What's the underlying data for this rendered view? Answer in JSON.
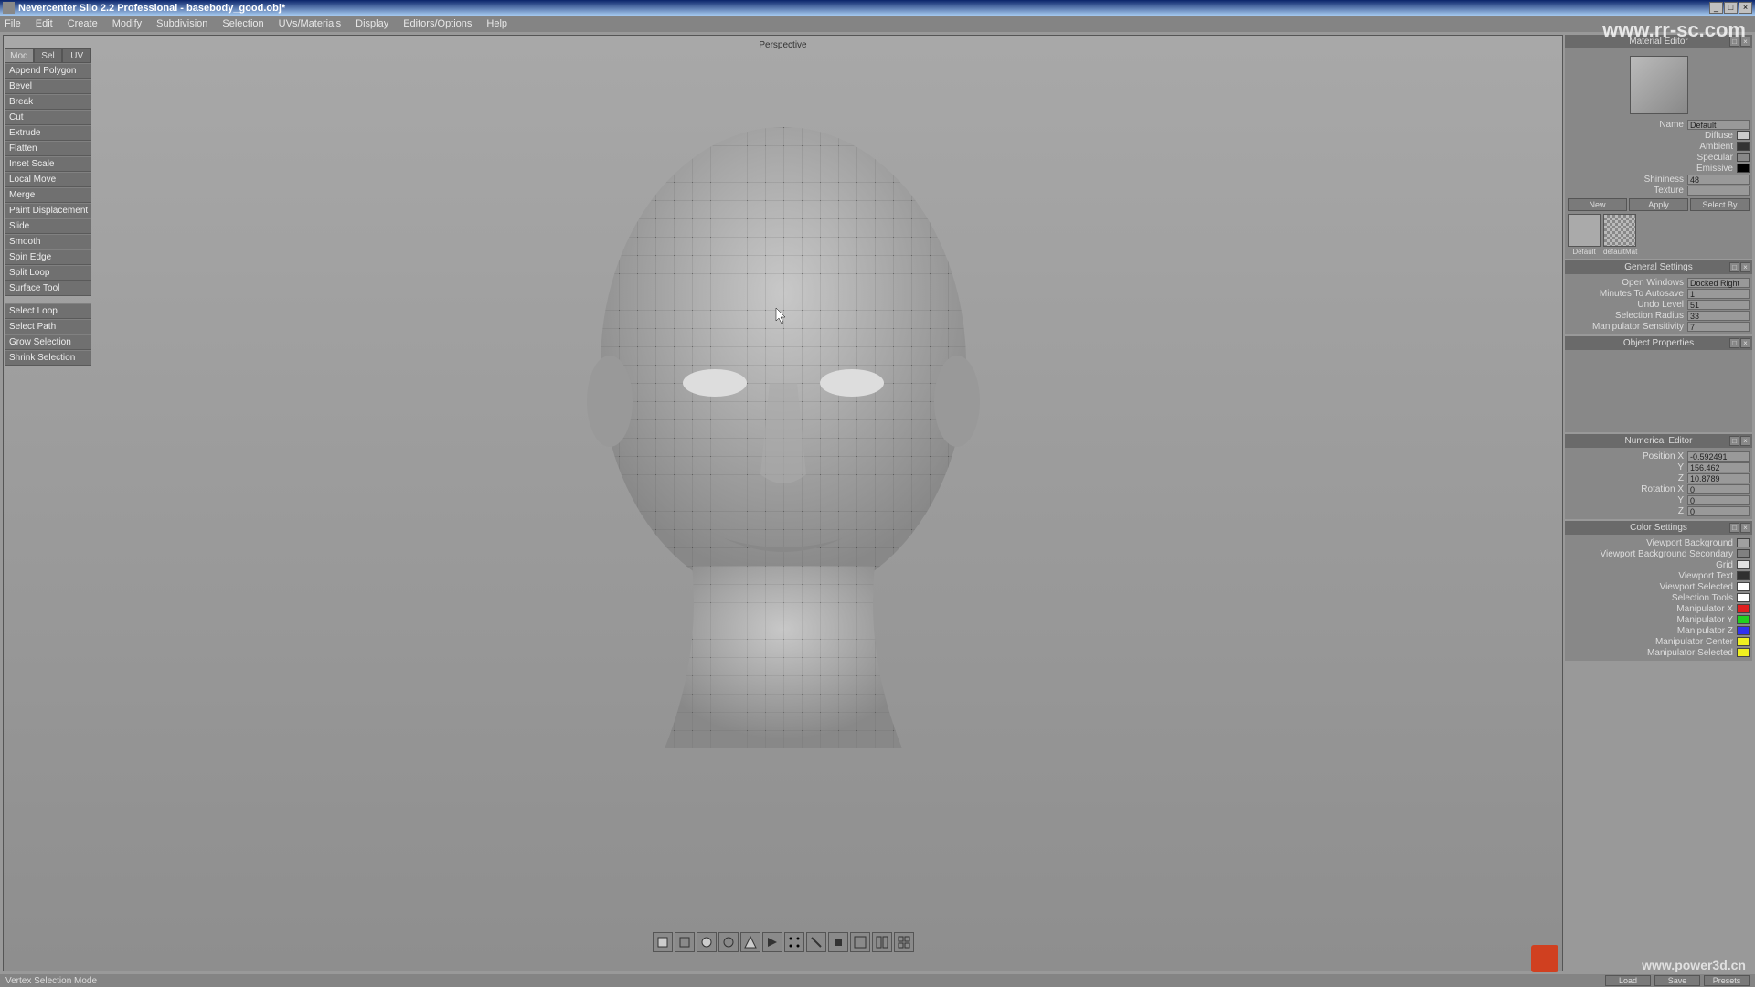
{
  "titlebar": {
    "text": "Nevercenter Silo 2.2 Professional - basebody_good.obj*"
  },
  "menubar": [
    "File",
    "Edit",
    "Create",
    "Modify",
    "Subdivision",
    "Selection",
    "UVs/Materials",
    "Display",
    "Editors/Options",
    "Help"
  ],
  "tabs": [
    "Mod",
    "Sel",
    "UV"
  ],
  "tools_group1": [
    "Append Polygon",
    "Bevel",
    "Break",
    "Cut",
    "Extrude",
    "Flatten",
    "Inset Scale",
    "Local Move",
    "Merge",
    "Paint Displacement",
    "Slide",
    "Smooth",
    "Spin Edge",
    "Split Loop",
    "Surface Tool"
  ],
  "tools_group2": [
    "Select Loop",
    "Select Path",
    "Grow Selection",
    "Shrink Selection"
  ],
  "viewport_label": "Perspective",
  "material_editor": {
    "title": "Material Editor",
    "name_label": "Name",
    "name_val": "Default",
    "diffuse_label": "Diffuse",
    "ambient_label": "Ambient",
    "specular_label": "Specular",
    "emissive_label": "Emissive",
    "shininess_label": "Shininess",
    "shininess_val": "48",
    "texture_label": "Texture",
    "btn_new": "New",
    "btn_apply": "Apply",
    "btn_selectby": "Select By",
    "thumb1": "Default",
    "thumb2": "defaultMat"
  },
  "general_settings": {
    "title": "General Settings",
    "open_windows_l": "Open Windows",
    "open_windows_v": "Docked Right",
    "autosave_l": "Minutes To Autosave",
    "autosave_v": "1",
    "undo_l": "Undo Level",
    "undo_v": "51",
    "selrad_l": "Selection Radius",
    "selrad_v": "33",
    "msens_l": "Manipulator Sensitivity",
    "msens_v": "7"
  },
  "object_properties": {
    "title": "Object Properties"
  },
  "numerical_editor": {
    "title": "Numerical Editor",
    "posx_l": "Position X",
    "posx_v": "-0.592491",
    "posy_l": "Y",
    "posy_v": "156.462",
    "posz_l": "Z",
    "posz_v": "10.8789",
    "rotx_l": "Rotation X",
    "rotx_v": "0",
    "roty_l": "Y",
    "roty_v": "0",
    "rotz_l": "Z",
    "rotz_v": "0"
  },
  "color_settings": {
    "title": "Color Settings",
    "rows": [
      {
        "l": "Viewport Background",
        "c": "#a0a0a0"
      },
      {
        "l": "Viewport Background Secondary",
        "c": "#808080"
      },
      {
        "l": "Grid",
        "c": "#e0e0e0"
      },
      {
        "l": "Viewport Text",
        "c": "#303030"
      },
      {
        "l": "Viewport Selected",
        "c": "#ffffff"
      },
      {
        "l": "Selection Tools",
        "c": "#ffffff"
      },
      {
        "l": "Manipulator X",
        "c": "#e02020"
      },
      {
        "l": "Manipulator Y",
        "c": "#20d020"
      },
      {
        "l": "Manipulator Z",
        "c": "#3030f0"
      },
      {
        "l": "Manipulator Center",
        "c": "#f0f020"
      },
      {
        "l": "Manipulator Selected",
        "c": "#f0f020"
      }
    ]
  },
  "status": {
    "mode": "Vertex Selection Mode",
    "btns": [
      "Load",
      "Save",
      "Presets"
    ]
  },
  "watermarks": {
    "tr": "www.rr-sc.com",
    "br": "www.power3d.cn"
  }
}
